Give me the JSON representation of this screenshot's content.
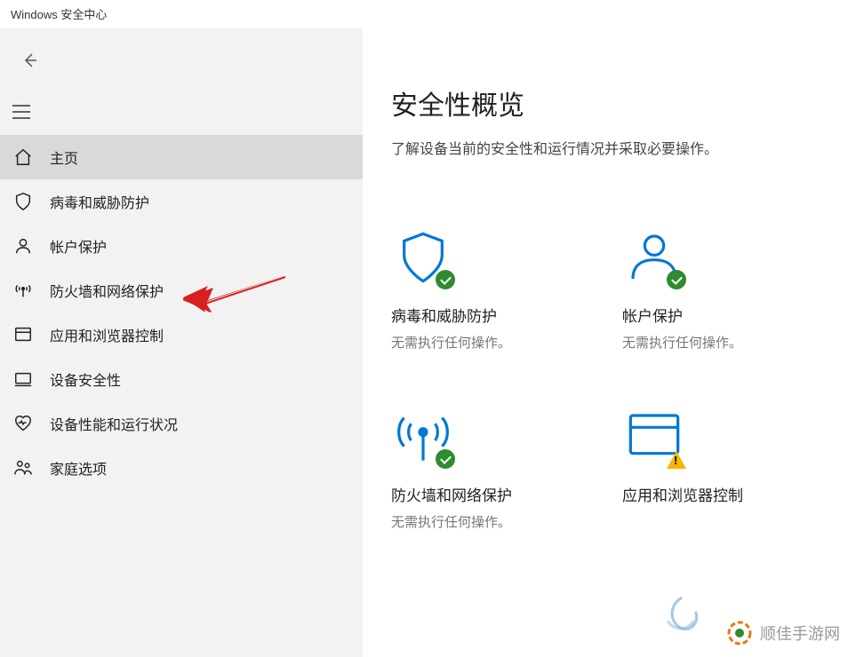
{
  "window": {
    "title": "Windows 安全中心"
  },
  "sidebar": {
    "items": [
      {
        "label": "主页",
        "icon": "home-icon",
        "active": true
      },
      {
        "label": "病毒和威胁防护",
        "icon": "shield-icon",
        "active": false
      },
      {
        "label": "帐户保护",
        "icon": "person-icon",
        "active": false
      },
      {
        "label": "防火墙和网络保护",
        "icon": "antenna-icon",
        "active": false
      },
      {
        "label": "应用和浏览器控制",
        "icon": "browser-icon",
        "active": false
      },
      {
        "label": "设备安全性",
        "icon": "device-icon",
        "active": false
      },
      {
        "label": "设备性能和运行状况",
        "icon": "heart-icon",
        "active": false
      },
      {
        "label": "家庭选项",
        "icon": "family-icon",
        "active": false
      }
    ]
  },
  "main": {
    "title": "安全性概览",
    "subtitle": "了解设备当前的安全性和运行情况并采取必要操作。"
  },
  "cards": [
    {
      "title": "病毒和威胁防护",
      "status": "无需执行任何操作。",
      "icon": "shield-large-icon",
      "badge": "ok"
    },
    {
      "title": "帐户保护",
      "status": "无需执行任何操作。",
      "icon": "person-large-icon",
      "badge": "ok"
    },
    {
      "title": "防火墙和网络保护",
      "status": "无需执行任何操作。",
      "icon": "antenna-large-icon",
      "badge": "ok"
    },
    {
      "title": "应用和浏览器控制",
      "status": "",
      "icon": "browser-large-icon",
      "badge": "warn"
    }
  ],
  "annotation": {
    "target": "防火墙和网络保护"
  },
  "watermark": {
    "text": "顺佳手游网"
  },
  "colors": {
    "accent": "#0078d4",
    "ok": "#2e8b2e",
    "warn": "#f7b500"
  }
}
